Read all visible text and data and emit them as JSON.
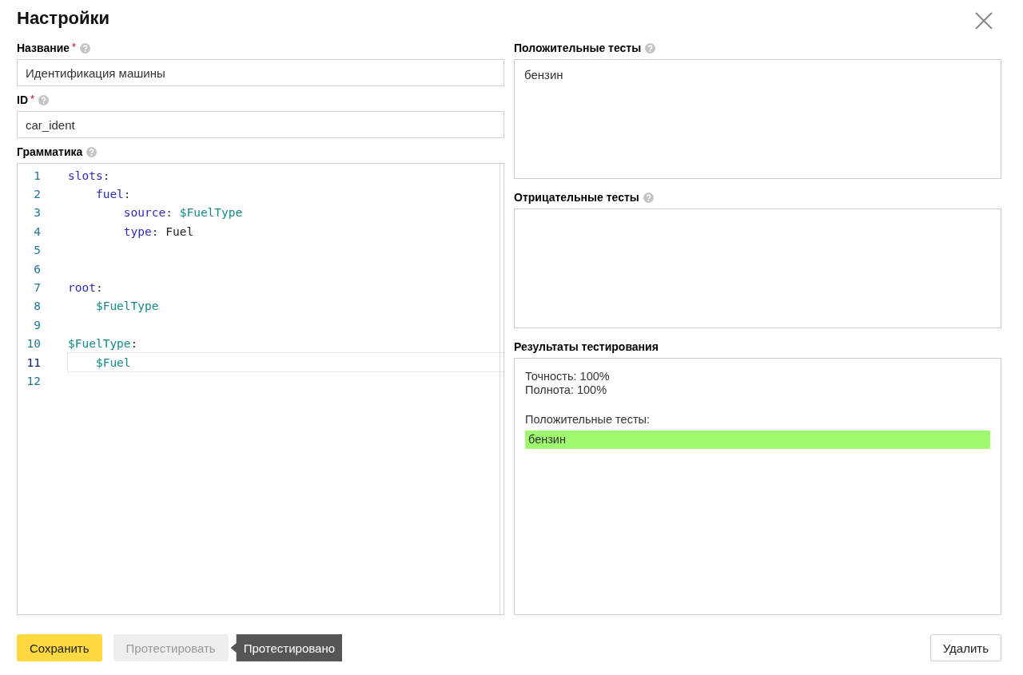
{
  "title": "Настройки",
  "fields": [
    {
      "label": "Название",
      "required_mark": "*",
      "value": "Идентификация машины"
    },
    {
      "label": "ID",
      "required_mark": "*",
      "value": "car_ident"
    }
  ],
  "grammar": {
    "label": "Грамматика",
    "lines": [
      {
        "number": "1",
        "current": false,
        "tokens": [
          {
            "kind": "key",
            "text": "slots"
          },
          {
            "kind": "punct",
            "text": ":"
          }
        ]
      },
      {
        "number": "2",
        "current": false,
        "tokens": [
          {
            "kind": "key",
            "text": "    fuel"
          },
          {
            "kind": "punct",
            "text": ":"
          }
        ]
      },
      {
        "number": "3",
        "current": false,
        "tokens": [
          {
            "kind": "key",
            "text": "        source"
          },
          {
            "kind": "punct",
            "text": ": "
          },
          {
            "kind": "var",
            "text": "$FuelType"
          }
        ]
      },
      {
        "number": "4",
        "current": false,
        "tokens": [
          {
            "kind": "key",
            "text": "        type"
          },
          {
            "kind": "punct",
            "text": ": "
          },
          {
            "kind": "plain",
            "text": "Fuel"
          }
        ]
      },
      {
        "number": "5",
        "current": false
      },
      {
        "number": "6",
        "current": false
      },
      {
        "number": "7",
        "current": false,
        "tokens": [
          {
            "kind": "key",
            "text": "root"
          },
          {
            "kind": "punct",
            "text": ":"
          }
        ]
      },
      {
        "number": "8",
        "current": false,
        "tokens": [
          {
            "kind": "var",
            "text": "    $FuelType"
          }
        ]
      },
      {
        "number": "9",
        "current": false
      },
      {
        "number": "10",
        "current": false,
        "tokens": [
          {
            "kind": "var",
            "text": "$FuelType"
          },
          {
            "kind": "punct",
            "text": ":"
          }
        ]
      },
      {
        "number": "11",
        "current": true,
        "tokens": [
          {
            "kind": "var",
            "text": "    $Fuel"
          }
        ]
      },
      {
        "number": "12",
        "current": false
      }
    ]
  },
  "positive_tests": {
    "label": "Положительные тесты",
    "value": "бензин"
  },
  "negative_tests": {
    "label": "Отрицательные тесты"
  },
  "results": {
    "label": "Результаты тестирования",
    "metrics": [
      "Точность: 100%",
      "Полнота: 100%"
    ],
    "section": "Положительные тесты:",
    "items": [
      {
        "text": "бензин",
        "passed": true
      }
    ]
  },
  "buttons": [
    {
      "kind": "primary",
      "label": "Сохранить",
      "disabled": false
    },
    {
      "kind": "secondary",
      "label": "Протестировать",
      "disabled": true
    }
  ],
  "tooltip": "Протестировано",
  "delete_button": {
    "label": "Удалить",
    "disabled": false
  }
}
